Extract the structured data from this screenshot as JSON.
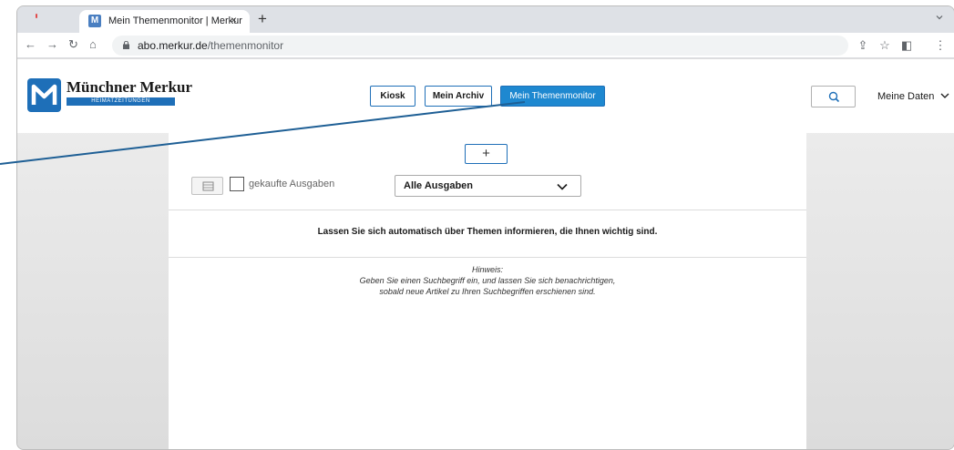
{
  "browser": {
    "tab_title": "Mein Themenmonitor | Merkur",
    "tab_close": "×",
    "new_tab": "+",
    "url_host": "abo.merkur.de",
    "url_path": "/themenmonitor",
    "icons": [
      "back-icon",
      "forward-icon",
      "reload-icon",
      "home-icon",
      "lock-icon",
      "share-icon",
      "bookmark-star-icon",
      "sidebar-icon",
      "kebab-menu-icon"
    ]
  },
  "header": {
    "logo_title": "Münchner Merkur",
    "logo_subtitle": "HEIMATZEITUNGEN",
    "nav": [
      "Kiosk",
      "Mein Archiv",
      "Mein Themenmonitor"
    ],
    "active_nav": "Mein Themenmonitor",
    "account_label": "Meine Daten"
  },
  "main": {
    "add_label": "+",
    "checkbox_label": "gekaufte Ausgaben",
    "select_value": "Alle Ausgaben",
    "info_text": "Lassen Sie sich automatisch über Themen informieren, die Ihnen wichtig sind.",
    "hint_title": "Hinweis:",
    "hint_line1": "Geben Sie einen Suchbegriff ein, und lassen Sie sich benachrichtigen,",
    "hint_line2": "sobald neue Artikel zu Ihren Suchbegriffen erschienen sind."
  },
  "colors": {
    "brand_blue": "#1e6fb8",
    "active_tab_blue": "#1e88d0",
    "callout_line": "#1e5f95"
  }
}
